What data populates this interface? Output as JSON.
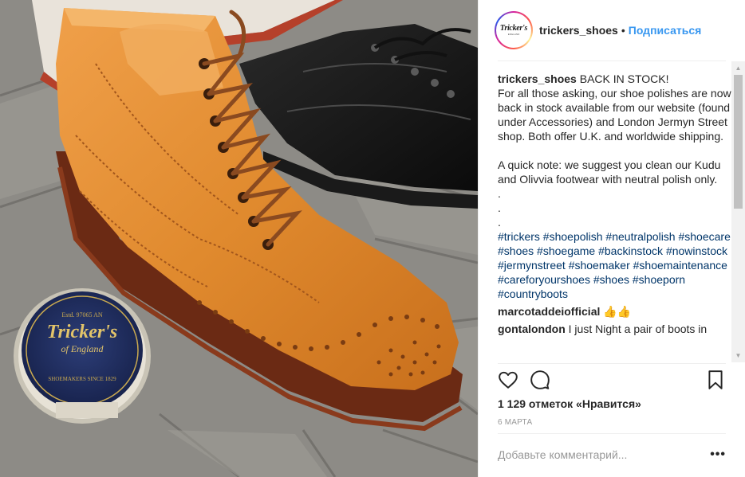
{
  "post": {
    "username": "trickers_shoes",
    "follow_label": "Подписаться",
    "header_dot": "•",
    "avatar": {
      "logo_text": "Tricker's",
      "logo_sub": "ENGLAND"
    },
    "caption": {
      "username": "trickers_shoes",
      "text": " BACK IN STOCK!\nFor all those asking, our shoe polishes are now back in stock available from our website (found under Accessories) and London Jermyn Street shop. Both offer U.K. and worldwide shipping.\n\nA quick note: we suggest you clean our Kudu and Olivvia footwear with neutral polish only.\n.\n.\n.",
      "hashtags": [
        "#trickers",
        "#shoepolish",
        "#neutralpolish",
        "#shoecare",
        "#shoes",
        "#shoegame",
        "#backinstock",
        "#nowinstock",
        "#jermynstreet",
        "#shoemaker",
        "#shoemaintenance",
        "#careforyourshoes",
        "#shoes",
        "#shoeporn",
        "#countryboots"
      ]
    },
    "comments": [
      {
        "username": "marcotaddeiofficial",
        "text": " 👍👍"
      },
      {
        "username": "gontalondon",
        "text": " I just Night a pair of boots in"
      }
    ],
    "likes_text": "1 129 отметок «Нравится»",
    "date_text": "6 МАРТА",
    "comment_placeholder": "Добавьте комментарий...",
    "more_label": "•••"
  },
  "photo": {
    "tin_top_text": "Estd. 97065 AN",
    "tin_brand": "Tricker's",
    "tin_sub": "of England",
    "tin_bottom_text": "SHOEMAKERS SINCE 1829"
  },
  "icons": [
    "heart-icon",
    "comment-icon",
    "bookmark-icon",
    "scroll-up-icon",
    "scroll-down-icon"
  ],
  "colors": {
    "link": "#3897f0",
    "hashtag": "#003569",
    "text": "#262626",
    "muted": "#999999"
  }
}
